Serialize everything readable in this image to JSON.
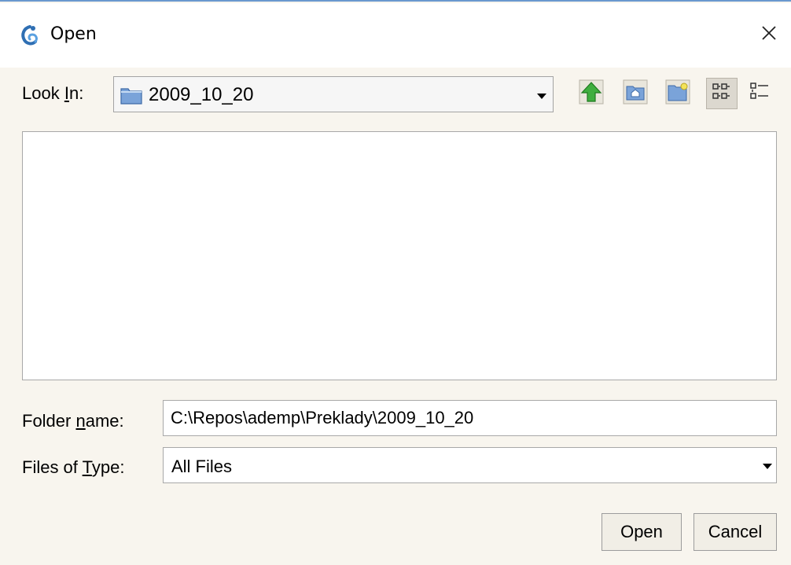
{
  "window": {
    "title": "Open",
    "close_symbol": "✕",
    "icon": "app-swirl-icon"
  },
  "look_in": {
    "label_pre": "Look ",
    "label_mnemonic": "I",
    "label_post": "n:",
    "value": "2009_10_20",
    "folder_icon": "folder-icon",
    "arrow_icon": "chevron-down-icon"
  },
  "toolbar": {
    "items": [
      "up-one-level-icon",
      "home-folder-icon",
      "new-folder-icon",
      "list-view-icon",
      "details-view-icon"
    ],
    "active": "list-view-icon"
  },
  "folder_name": {
    "label_pre": "Folder ",
    "label_mnemonic": "n",
    "label_post": "ame:",
    "value": "C:\\Repos\\ademp\\Preklady\\2009_10_20"
  },
  "files_of_type": {
    "label_pre": "Files of ",
    "label_mnemonic": "T",
    "label_post": "ype:",
    "value": "All Files"
  },
  "buttons": {
    "open": "Open",
    "cancel": "Cancel"
  },
  "colors": {
    "window_bg": "#f8f5ee",
    "title_bar_bg": "#ffffff",
    "accent_border": "#6a98cf",
    "up_arrow_green": "#3fae3f",
    "folder_blue": "#7aa3d9"
  }
}
